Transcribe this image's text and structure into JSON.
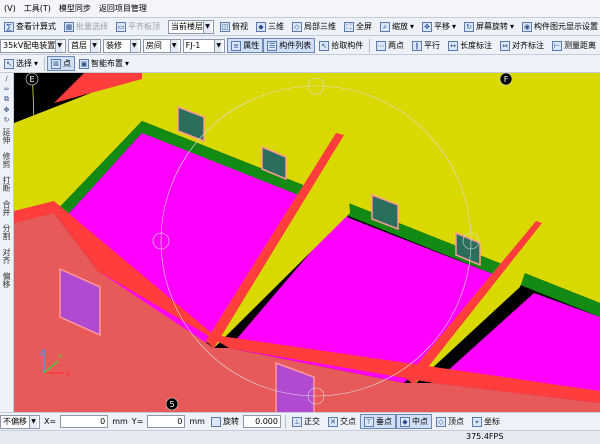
{
  "menu": [
    "(V)",
    "工具(T)",
    "模型同步",
    "返回项目管理"
  ],
  "toolbar1": {
    "view_calc": "查看计算式",
    "batch_select": "批量选择",
    "flush_board": "平齐板顶",
    "current_floor": "当前楼层",
    "plan_view": "俯视",
    "three_d": "三维",
    "local_three_d": "局部三维",
    "fullscreen": "全屏",
    "zoom": "缩放",
    "pan": "平移",
    "screen_rotate": "屏幕旋转",
    "component_display": "构件图元显示设置"
  },
  "toolbar2": {
    "project": "35kV配电装置",
    "floor": "首层",
    "category": "装修",
    "type": "房间",
    "element": "FJ-1",
    "properties": "属性",
    "component_list": "构件列表",
    "pick_component": "拾取构件",
    "two_points": "两点",
    "parallel": "平行",
    "length_dim": "长度标注",
    "align_dim": "对齐标注",
    "measure_dist": "测量距离"
  },
  "toolbar3": {
    "select": "选择",
    "smart_layout": "智能布置"
  },
  "left_tools": [
    "延伸",
    "修剪",
    "打断",
    "合并",
    "分割",
    "对齐",
    "偏移"
  ],
  "axis_labels": {
    "e": "E",
    "f": "F",
    "five": "5"
  },
  "status": {
    "no_offset": "不偏移",
    "x_label": "X=",
    "x_value": "0",
    "y_label": "Y=",
    "y_value": "0",
    "unit": "mm",
    "rotate": "旋转",
    "rotate_value": "0.000",
    "orthogonal": "正交",
    "intersection": "交点",
    "vertical_point": "垂点",
    "midpoint": "中点",
    "vertex": "顶点",
    "coordinate": "坐标"
  },
  "fps": "375.4FPS",
  "colors": {
    "wall_side": "#e85a5a",
    "wall_top": "#ff3d3d",
    "wall_inner": "#d9d900",
    "floor": "#ff00ff",
    "baseboard": "#138a13",
    "window": "#2c6e5c",
    "door": "#b04ad1",
    "axis_line": "#ffff66"
  }
}
